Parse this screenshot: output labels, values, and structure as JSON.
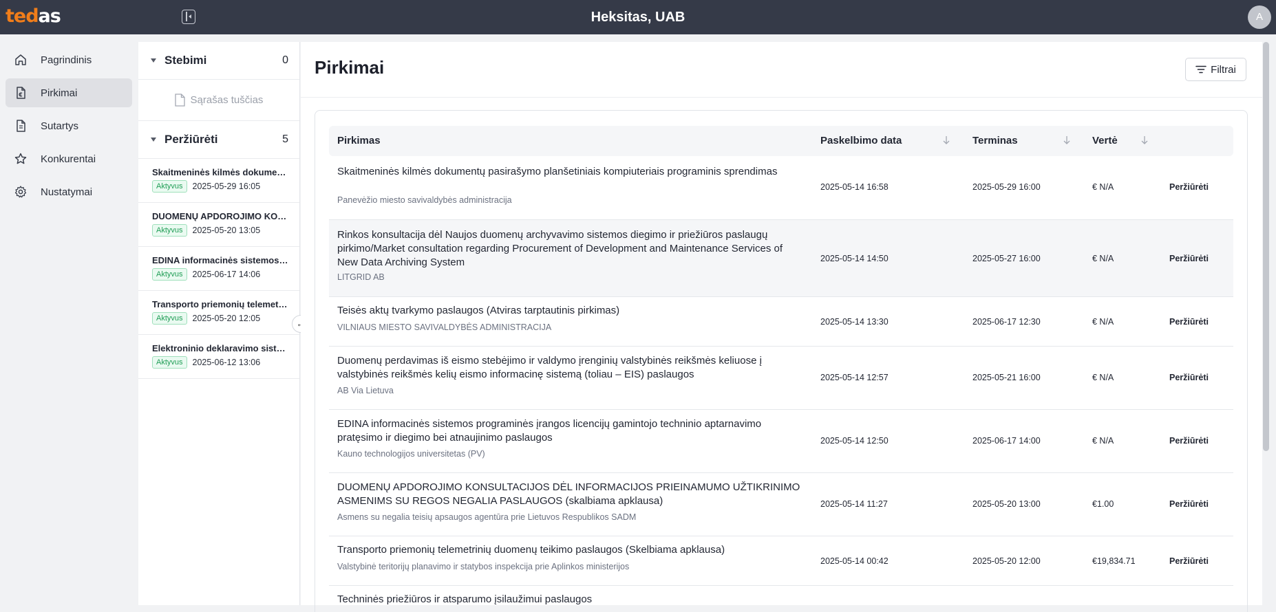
{
  "app": {
    "logo_part1": "ted",
    "logo_part2": "as",
    "company": "Heksitas, UAB",
    "avatar_initial": "A",
    "accent_color": "#f07d1a",
    "topbar_color": "#353a48"
  },
  "sidebar": {
    "items": [
      {
        "label": "Pagrindinis",
        "icon": "home-icon"
      },
      {
        "label": "Pirkimai",
        "icon": "document-euro-icon",
        "active": true
      },
      {
        "label": "Sutartys",
        "icon": "document-icon"
      },
      {
        "label": "Konkurentai",
        "icon": "star-icon"
      },
      {
        "label": "Nustatymai",
        "icon": "gear-icon"
      }
    ]
  },
  "panel": {
    "watching": {
      "title": "Stebimi",
      "count": "0",
      "empty_text": "Sąrašas tuščias"
    },
    "viewed": {
      "title": "Peržiūrėti",
      "count": "5",
      "items": [
        {
          "title": "Skaitmeninės kilmės dokumentų pasirašymo planšetiniais kompiuteriais programinis sprendimas",
          "status": "Aktyvus",
          "date": "2025-05-29 16:05"
        },
        {
          "title": "DUOMENŲ APDOROJIMO KONSULTACIJOS DĖL INFORMACIJOS PRIEINAMUMO UŽTIKRINIMO ASMENIMS SU REGOS NEGALIA PASLAUGOS",
          "status": "Aktyvus",
          "date": "2025-05-20 13:05"
        },
        {
          "title": "EDINA informacinės sistemos programinės įrangos licencijų gamintojo techninio aptarnavimo pratęsimo ir diegimo bei atnaujinimo paslaugos",
          "status": "Aktyvus",
          "date": "2025-06-17 14:06"
        },
        {
          "title": "Transporto priemonių telemetrinių duomenų teikimo paslaugos",
          "status": "Aktyvus",
          "date": "2025-05-20 12:05"
        },
        {
          "title": "Elektroninio deklaravimo sistemos",
          "status": "Aktyvus",
          "date": "2025-06-12 13:06"
        }
      ]
    }
  },
  "main": {
    "title": "Pirkimai",
    "filter_label": "Filtrai",
    "columns": {
      "title": "Pirkimas",
      "published": "Paskelbimo data",
      "deadline": "Terminas",
      "value": "Vertė"
    },
    "rows": [
      {
        "title": "Skaitmeninės kilmės dokumentų pasirašymo planšetiniais kompiuteriais programinis sprendimas",
        "org": "Panevėžio miesto savivaldybės administracija",
        "published": "2025-05-14 16:58",
        "deadline": "2025-05-29 16:00",
        "value": "€ N/A",
        "action": "Peržiūrėti"
      },
      {
        "title": "Rinkos konsultacija dėl Naujos duomenų archyvavimo sistemos diegimo ir priežiūros paslaugų pirkimo/Market consultation regarding Procurement of Development and Maintenance Services of New Data Archiving System",
        "org": "LITGRID AB",
        "published": "2025-05-14 14:50",
        "deadline": "2025-05-27 16:00",
        "value": "€ N/A",
        "action": "Peržiūrėti"
      },
      {
        "title": "Teisės aktų tvarkymo paslaugos (Atviras tarptautinis pirkimas)",
        "org": "VILNIAUS MIESTO SAVIVALDYBĖS ADMINISTRACIJA",
        "published": "2025-05-14 13:30",
        "deadline": "2025-06-17 12:30",
        "value": "€ N/A",
        "action": "Peržiūrėti"
      },
      {
        "title": "Duomenų perdavimas iš eismo stebėjimo ir valdymo įrenginių valstybinės reikšmės keliuose į valstybinės reikšmės kelių eismo informacinę sistemą (toliau – EIS) paslaugos",
        "org": "AB Via Lietuva",
        "published": "2025-05-14 12:57",
        "deadline": "2025-05-21 16:00",
        "value": "€ N/A",
        "action": "Peržiūrėti"
      },
      {
        "title": "EDINA informacinės sistemos programinės įrangos licencijų gamintojo techninio aptarnavimo pratęsimo ir diegimo bei atnaujinimo paslaugos",
        "org": "Kauno technologijos universitetas (PV)",
        "published": "2025-05-14 12:50",
        "deadline": "2025-06-17 14:00",
        "value": "€ N/A",
        "action": "Peržiūrėti"
      },
      {
        "title": "DUOMENŲ APDOROJIMO KONSULTACIJOS DĖL INFORMACIJOS PRIEINAMUMO UŽTIKRINIMO ASMENIMS SU REGOS NEGALIA PASLAUGOS (skalbiama apklausa)",
        "org": "Asmens su negalia teisių apsaugos agentūra prie Lietuvos Respublikos SADM",
        "published": "2025-05-14 11:27",
        "deadline": "2025-05-20 13:00",
        "value": "€1.00",
        "action": "Peržiūrėti"
      },
      {
        "title": "Transporto priemonių telemetrinių duomenų teikimo paslaugos (Skelbiama apklausa)",
        "org": "Valstybinė teritorijų planavimo ir statybos inspekcija prie Aplinkos ministerijos",
        "published": "2025-05-14 00:42",
        "deadline": "2025-05-20 12:00",
        "value": "€19,834.71",
        "action": "Peržiūrėti"
      },
      {
        "title": "Techninės priežiūros ir atsparumo įsilaužimui paslaugos"
      }
    ]
  }
}
